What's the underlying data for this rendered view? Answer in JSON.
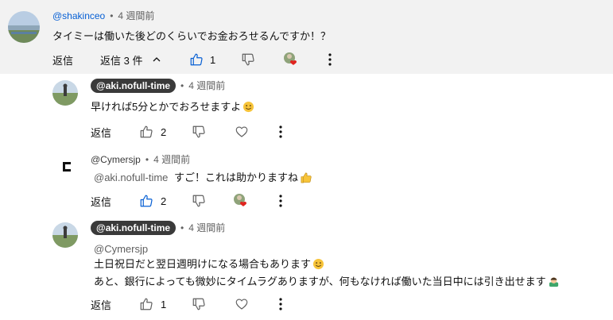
{
  "comments": [
    {
      "handle": "@shakinceo",
      "time": "4 週間前",
      "text": "タイミーは働いた後どのくらいでお金おろせるんですか！？",
      "reply_label": "返信",
      "replies_label": "返信 3 件",
      "likes": "1"
    },
    {
      "handle": "@aki.nofull-time",
      "time": "4 週間前",
      "text": "早ければ5分とかでおろせますよ",
      "reply_label": "返信",
      "likes": "2"
    },
    {
      "handle": "@Cymersjp",
      "time": "4 週間前",
      "mention": "@aki.nofull-time",
      "text": "すご！これは助かりますね",
      "reply_label": "返信",
      "likes": "2"
    },
    {
      "handle": "@aki.nofull-time",
      "time": "4 週間前",
      "mention": "@Cymersjp",
      "line1": "土日祝日だと翌日週明けになる場合もあります",
      "line2": "あと、銀行によっても微妙にタイムラグありますが、何もなければ働いた当日中には引き出せます",
      "reply_label": "返信",
      "likes": "1"
    }
  ],
  "icons": {
    "like": "thumbs-up-icon",
    "dislike": "thumbs-down-icon",
    "heart": "creator-heart-icon",
    "more": "more-vert-icon",
    "chevron": "chevron-up-icon",
    "cymers_logo": "cymers-logo"
  },
  "colors": {
    "link": "#065fd4",
    "pill": "#3a3a3a",
    "heart": "#e0241f",
    "band": "#f2f2f2"
  }
}
